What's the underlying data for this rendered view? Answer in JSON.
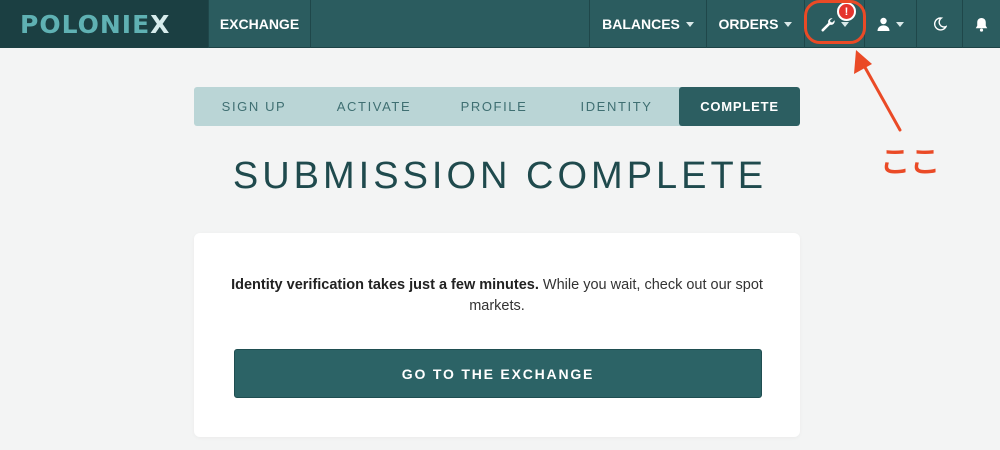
{
  "brand": {
    "logo_main": "POLONIE",
    "logo_x": "X"
  },
  "nav": {
    "exchange": "EXCHANGE",
    "balances": "BALANCES",
    "orders": "ORDERS",
    "alert_badge": "!",
    "icons": [
      "wrench-icon",
      "user-icon",
      "moon-icon",
      "bell-icon"
    ]
  },
  "annotation": {
    "label": "ここ",
    "color": "#ea4a26"
  },
  "steps": [
    {
      "label": "SIGN UP",
      "active": false
    },
    {
      "label": "ACTIVATE",
      "active": false
    },
    {
      "label": "PROFILE",
      "active": false
    },
    {
      "label": "IDENTITY",
      "active": false
    },
    {
      "label": "COMPLETE",
      "active": true
    }
  ],
  "page": {
    "title": "SUBMISSION COMPLETE"
  },
  "card": {
    "message_bold": "Identity verification takes just a few minutes.",
    "message_rest": " While you wait, check out our spot markets.",
    "button_label": "GO TO THE EXCHANGE"
  },
  "colors": {
    "topbar": "#2b5c5f",
    "logo_bg": "#1b3f42",
    "accent": "#2c6366",
    "steps_bg": "#bad5d6",
    "alert": "#e5342e"
  }
}
